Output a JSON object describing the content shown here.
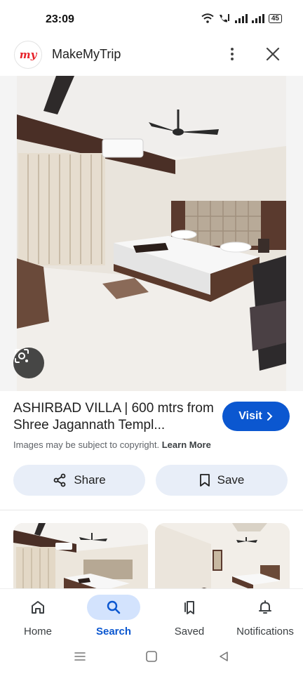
{
  "status_bar": {
    "time": "23:09",
    "battery": "45"
  },
  "header": {
    "app_name": "MakeMyTrip",
    "logo_text": "my"
  },
  "result": {
    "title": "ASHIRBAD VILLA | 600 mtrs from Shree Jagannath Templ...",
    "visit_label": "Visit",
    "copyright_text": "Images may be subject to copyright.",
    "learn_more_label": "Learn More",
    "share_label": "Share",
    "save_label": "Save"
  },
  "bottom_nav": {
    "items": [
      {
        "label": "Home",
        "icon": "home-icon"
      },
      {
        "label": "Search",
        "icon": "search-icon",
        "active": true
      },
      {
        "label": "Saved",
        "icon": "saved-icon"
      },
      {
        "label": "Notifications",
        "icon": "bell-icon"
      }
    ]
  },
  "colors": {
    "accent": "#0b57d0",
    "pill_bg": "#e8eef8",
    "active_pill": "#d3e3fd",
    "brand_red": "#e7222a"
  }
}
